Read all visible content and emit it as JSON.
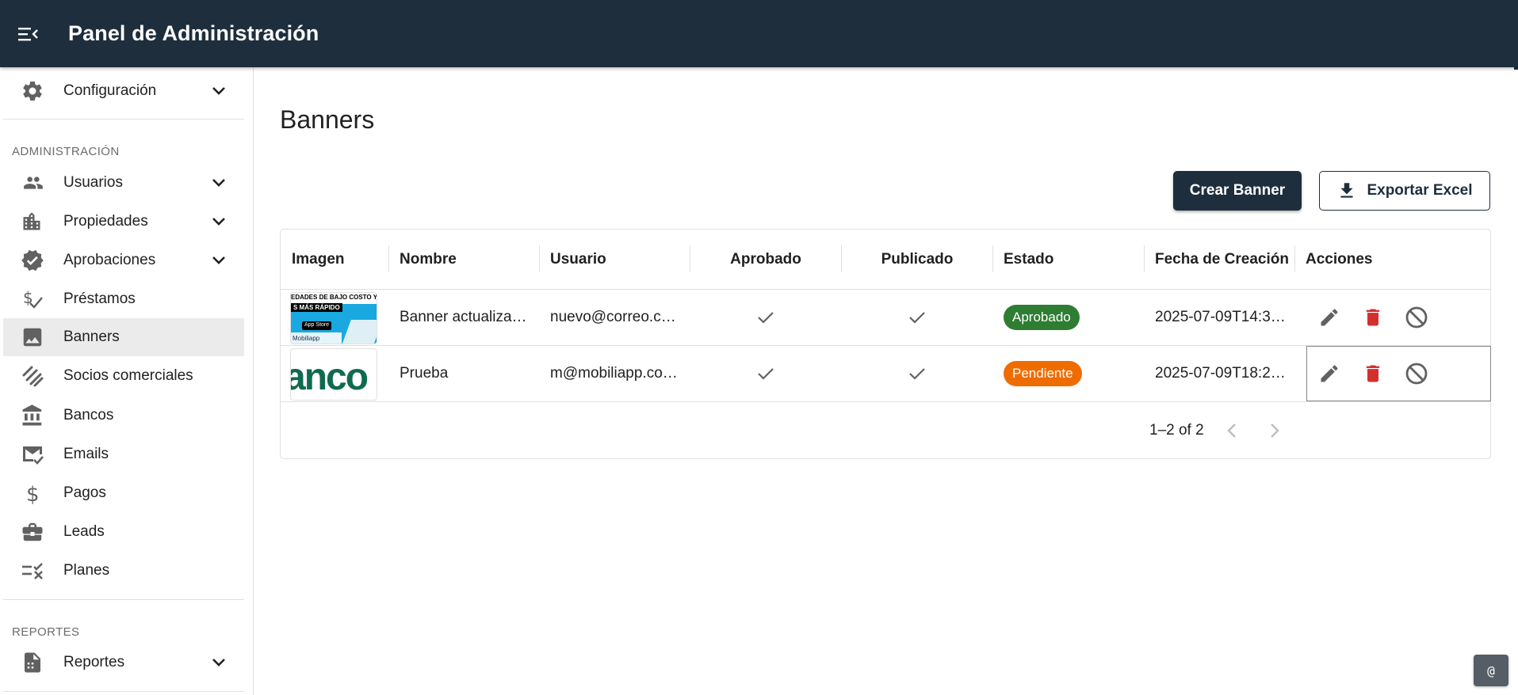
{
  "app": {
    "title": "Panel de Administración",
    "colors": {
      "appbar": "#1e2e3d",
      "approved": "#2e7d32",
      "pending": "#ef6c00",
      "delete": "#d32f2f"
    }
  },
  "sidebar": {
    "config": {
      "label": "Configuración",
      "icon": "gear-icon"
    },
    "admin_header": "ADMINISTRACIÓN",
    "items": [
      {
        "label": "Usuarios",
        "icon": "people-icon",
        "expandable": true
      },
      {
        "label": "Propiedades",
        "icon": "building-icon",
        "expandable": true
      },
      {
        "label": "Aprobaciones",
        "icon": "verified-badge-icon",
        "expandable": true
      },
      {
        "label": "Préstamos",
        "icon": "loan-icon",
        "expandable": false
      },
      {
        "label": "Banners",
        "icon": "image-icon",
        "expandable": false,
        "selected": true
      },
      {
        "label": "Socios comerciales",
        "icon": "handshake-icon",
        "expandable": false
      },
      {
        "label": "Bancos",
        "icon": "bank-icon",
        "expandable": false
      },
      {
        "label": "Emails",
        "icon": "mail-check-icon",
        "expandable": false
      },
      {
        "label": "Pagos",
        "icon": "dollar-icon",
        "expandable": false
      },
      {
        "label": "Leads",
        "icon": "briefcase-icon",
        "expandable": false
      },
      {
        "label": "Planes",
        "icon": "checklist-icon",
        "expandable": false
      }
    ],
    "reports_header": "REPORTES",
    "reports": {
      "label": "Reportes",
      "icon": "report-icon"
    }
  },
  "main": {
    "title": "Banners",
    "create_button": "Crear Banner",
    "export_button": "Exportar Excel",
    "columns": [
      "Imagen",
      "Nombre",
      "Usuario",
      "Aprobado",
      "Publicado",
      "Estado",
      "Fecha de Creación",
      "Acciones"
    ],
    "rows": [
      {
        "thumb_lines": [
          "EDADES DE BAJO COSTO Y",
          "S MÁS RÁPIDO",
          "App Store",
          "Mobiliapp"
        ],
        "nombre": "Banner actualiza…",
        "usuario": "nuevo@correo.c…",
        "aprobado": true,
        "publicado": true,
        "estado": "Aprobado",
        "fecha": "2025-07-09T14:3…"
      },
      {
        "thumb_lines": [
          "anco"
        ],
        "nombre": "Prueba",
        "usuario": "m@mobiliapp.co…",
        "aprobado": true,
        "publicado": true,
        "estado": "Pendiente",
        "fecha": "2025-07-09T18:2…"
      }
    ],
    "pagination": {
      "text": "1–2 of 2"
    }
  },
  "corner_badge": "@"
}
